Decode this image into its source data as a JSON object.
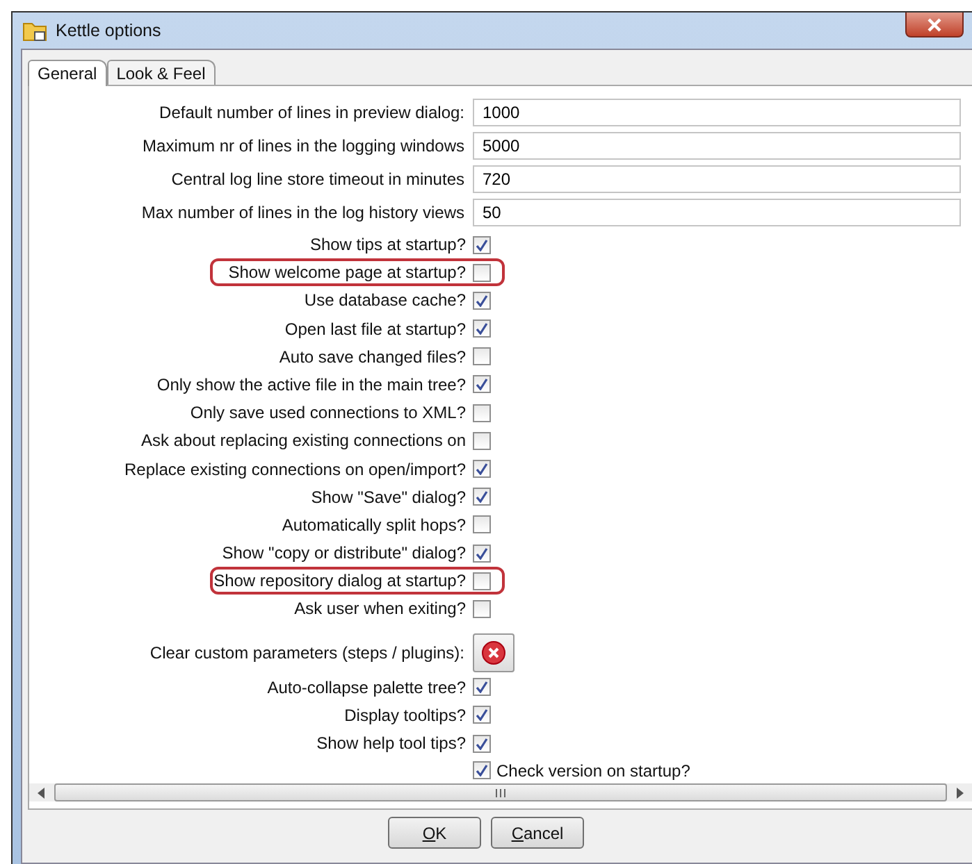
{
  "window": {
    "title": "Kettle options"
  },
  "tabs": [
    {
      "label": "General",
      "selected": true
    },
    {
      "label": "Look & Feel",
      "selected": false
    }
  ],
  "options": [
    {
      "kind": "field",
      "label": "Default number of lines in preview dialog:",
      "value": "1000"
    },
    {
      "kind": "field",
      "label": "Maximum nr of lines in the logging windows",
      "value": "5000"
    },
    {
      "kind": "field",
      "label": "Central log line store timeout in minutes",
      "value": "720"
    },
    {
      "kind": "field",
      "label": "Max number of lines in the log history views",
      "value": "50"
    },
    {
      "kind": "checkbox",
      "label": "Show tips at startup?",
      "checked": true,
      "highlighted": false
    },
    {
      "kind": "checkbox",
      "label": "Show welcome page at startup?",
      "checked": false,
      "highlighted": true
    },
    {
      "kind": "checkbox",
      "label": "Use database cache?",
      "checked": true,
      "highlighted": false
    },
    {
      "kind": "checkbox",
      "label": "Open last file at startup?",
      "checked": true,
      "highlighted": false
    },
    {
      "kind": "checkbox",
      "label": "Auto save changed files?",
      "checked": false,
      "highlighted": false
    },
    {
      "kind": "checkbox",
      "label": "Only show the active file in the main tree?",
      "checked": true,
      "highlighted": false
    },
    {
      "kind": "checkbox",
      "label": "Only save used connections to XML?",
      "checked": false,
      "highlighted": false
    },
    {
      "kind": "checkbox",
      "label": "Ask about replacing existing connections on",
      "checked": false,
      "highlighted": false
    },
    {
      "kind": "checkbox",
      "label": "Replace existing connections on open/import?",
      "checked": true,
      "highlighted": false
    },
    {
      "kind": "checkbox",
      "label": "Show \"Save\" dialog?",
      "checked": true,
      "highlighted": false
    },
    {
      "kind": "checkbox",
      "label": "Automatically split hops?",
      "checked": false,
      "highlighted": false
    },
    {
      "kind": "checkbox",
      "label": "Show \"copy or distribute\" dialog?",
      "checked": true,
      "highlighted": false
    },
    {
      "kind": "checkbox",
      "label": "Show repository dialog at startup?",
      "checked": false,
      "highlighted": true
    },
    {
      "kind": "checkbox",
      "label": "Ask user when exiting?",
      "checked": false,
      "highlighted": false
    },
    {
      "kind": "button",
      "label": "Clear custom parameters (steps / plugins):"
    },
    {
      "kind": "checkbox",
      "label": "Auto-collapse palette tree?",
      "checked": true,
      "highlighted": false
    },
    {
      "kind": "checkbox",
      "label": "Display tooltips?",
      "checked": true,
      "highlighted": false
    },
    {
      "kind": "checkbox",
      "label": "Show help tool tips?",
      "checked": true,
      "highlighted": false
    },
    {
      "kind": "trailing_checkbox",
      "label": "Check version on startup?",
      "checked": true,
      "highlighted": false
    }
  ],
  "buttons": [
    "OK",
    "Cancel"
  ]
}
